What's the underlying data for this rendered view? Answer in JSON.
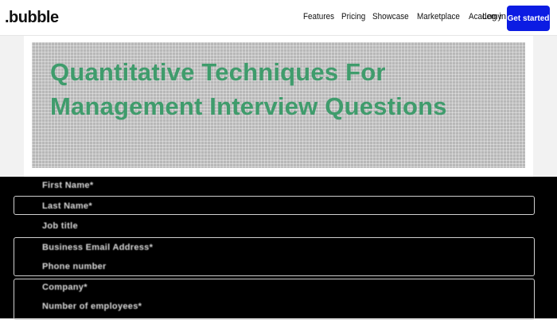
{
  "navbar": {
    "logo": ".bubble",
    "links": [
      "Features",
      "Pricing",
      "Showcase",
      "Marketplace",
      "Academy"
    ],
    "login": "Log in",
    "cta": "Get started"
  },
  "hero": {
    "title": "Quantitative Techniques For Management Interview Questions"
  },
  "form": {
    "fields": [
      "First Name*",
      "Last Name*",
      "Job title",
      "Business Email Address*",
      "Phone number",
      "Company*",
      "Number of employees*"
    ]
  }
}
